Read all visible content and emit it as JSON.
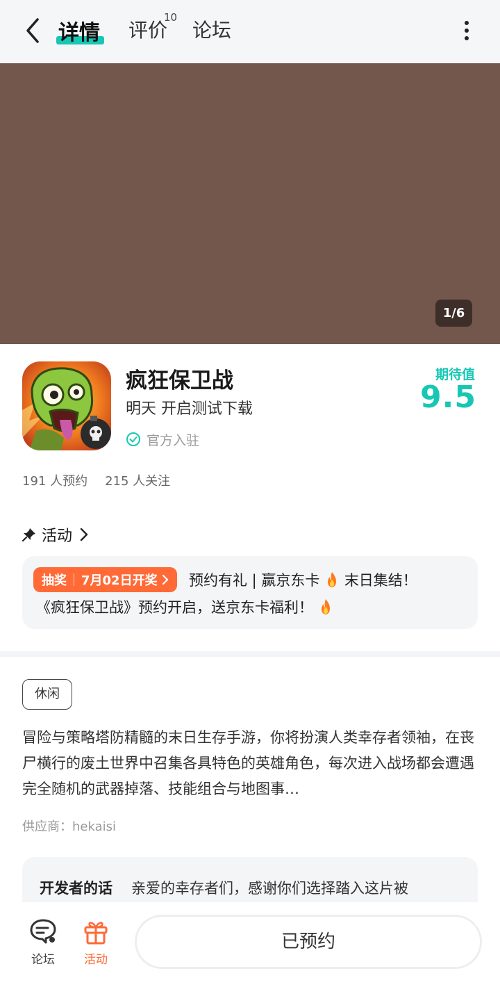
{
  "header": {
    "tabs": [
      {
        "label": "详情"
      },
      {
        "label": "评价",
        "count": "10"
      },
      {
        "label": "论坛"
      }
    ]
  },
  "media": {
    "counter": "1/6",
    "background_color": "#73574c"
  },
  "game": {
    "title": "疯狂保卫战",
    "status": "明天 开启测试下载",
    "official_label": "官方入驻",
    "anticipation_label": "期待值",
    "anticipation_value": "9.5",
    "reservations": "191 人预约",
    "followers": "215 人关注"
  },
  "activity": {
    "section_label": "活动",
    "badge_type": "抽奖",
    "badge_date": "7月02日开奖",
    "line1": "预约有礼 | 赢京东卡",
    "line1_tail": "末日集结！",
    "line2": "《疯狂保卫战》预约开启，送京东卡福利！"
  },
  "description": {
    "tag": "休闲",
    "text": "冒险与策略塔防精髓的末日生存手游，你将扮演人类幸存者领袖，在丧尸横行的废土世界中召集各具特色的英雄角色，每次进入战场都会遭遇完全随机的武器掉落、技能组合与地图事…",
    "supplier": "供应商：hekaisi"
  },
  "developer": {
    "label": "开发者的话",
    "text": "亲爱的幸存者们，感谢你们选择踏入这片被"
  },
  "bottom_bar": {
    "forum_label": "论坛",
    "activity_label": "活动",
    "reserve_label": "已预约"
  },
  "colors": {
    "accent": "#17c7b4",
    "orange": "#ff6a36"
  },
  "icons": [
    "back-arrow-icon",
    "more-vertical-icon",
    "verified-check-icon",
    "pin-icon",
    "chevron-right-icon",
    "fire-icon",
    "forum-chat-icon",
    "gift-icon"
  ]
}
